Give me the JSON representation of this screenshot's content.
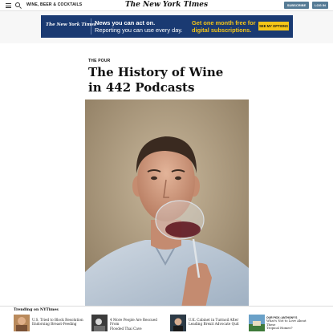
{
  "header": {
    "section": "WINE, BEER & COCKTAILS",
    "masthead": "The New York Times",
    "subscribe_label": "SUBSCRIBE",
    "login_label": "LOG IN"
  },
  "ad": {
    "logo": "The New York Times",
    "line1": "News you can act on.",
    "line2": "Reporting you can use every day.",
    "offer1": "Get one month free for",
    "offer2": "digital subscriptions.",
    "cta": "SEE MY OPTIONS"
  },
  "article": {
    "kicker": "THE POUR",
    "headline_line1": "The History of Wine",
    "headline_line2": "in 442 Podcasts"
  },
  "trending": {
    "label": "Trending on NYTimes",
    "items": [
      {
        "line1": "U.S. Tried to Block Resolution",
        "line2": "Endorsing Breast-Feeding"
      },
      {
        "line1": "4 More People Are Rescued From",
        "line2": "Flooded Thai Cave"
      },
      {
        "line1": "U.K. Cabinet in Turmoil After",
        "line2": "Leading Brexit Advocate Quit"
      },
      {
        "kicker": "OUR PICK: ANTHONY'S",
        "line1": "What's Not to Love About These",
        "line2": "Tropical Homes?"
      }
    ]
  },
  "colors": {
    "ad_bg": "#1a3a72",
    "ad_accent": "#f5c518",
    "button_blue": "#567b95"
  }
}
